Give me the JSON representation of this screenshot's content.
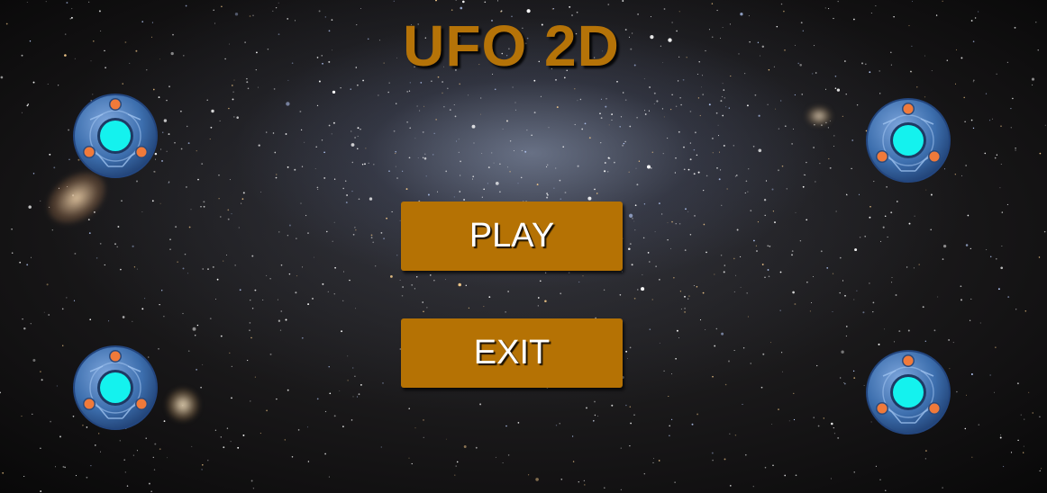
{
  "title": "UFO 2D",
  "menu": {
    "play_label": "PLAY",
    "exit_label": "EXIT"
  },
  "colors": {
    "title": "#b57308",
    "button_background": "#b57204",
    "button_text": "#ffffff",
    "ufo_hull": "#3d6fae",
    "ufo_core": "#14f2ee",
    "ufo_lights": "#f07a3a"
  },
  "decorations": {
    "ufo_icon_name": "ufo-icon",
    "ufo_count": 4
  }
}
